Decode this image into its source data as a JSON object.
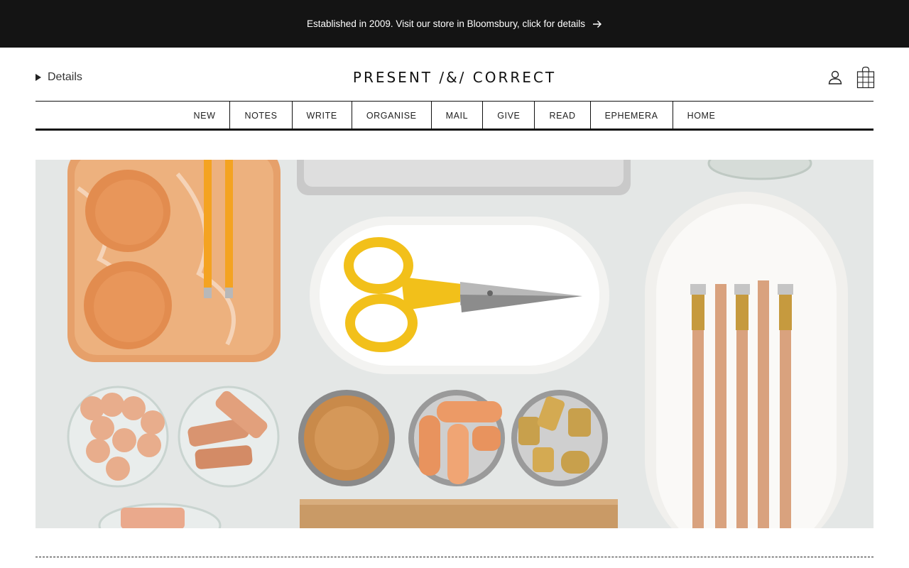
{
  "announcement": {
    "text": "Established in 2009. Visit our store in Bloomsbury, click for details"
  },
  "header": {
    "details_label": "Details",
    "logo": "PRESENT /&/ CORRECT"
  },
  "icons": {
    "account": "account-icon",
    "bag": "shopping-bag-icon",
    "arrow": "arrow-right-icon",
    "disclosure": "disclosure-triangle-icon"
  },
  "nav": {
    "items": [
      "NEW",
      "NOTES",
      "WRITE",
      "ORGANISE",
      "MAIL",
      "GIVE",
      "READ",
      "EPHEMERA",
      "HOME"
    ]
  },
  "colors": {
    "announcement_bg": "#141414",
    "accent_orange": "#e08a4a",
    "scissors_yellow": "#f2c01a"
  }
}
